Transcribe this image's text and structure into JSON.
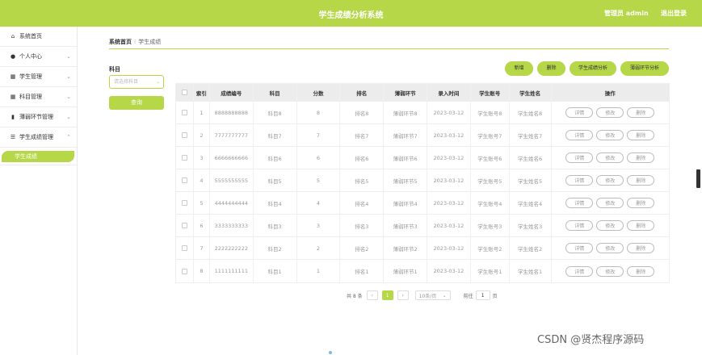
{
  "header": {
    "title": "学生成绩分析系统",
    "user": "管理员 admin",
    "logout": "退出登录"
  },
  "sidebar": {
    "items": [
      {
        "icon": "home-icon",
        "glyph": "⌂",
        "label": "系统首页",
        "chevron": ""
      },
      {
        "icon": "user-icon",
        "glyph": "●",
        "label": "个人中心",
        "chevron": "⌄"
      },
      {
        "icon": "grid-icon",
        "glyph": "▦",
        "label": "学生管理",
        "chevron": "⌄"
      },
      {
        "icon": "grid-icon",
        "glyph": "▦",
        "label": "科目管理",
        "chevron": "⌄"
      },
      {
        "icon": "bar-chart-icon",
        "glyph": "▮",
        "label": "薄弱环节管理",
        "chevron": "⌄"
      },
      {
        "icon": "list-icon",
        "glyph": "☰",
        "label": "学生成绩管理",
        "chevron": "⌃"
      }
    ],
    "active_sub": "学生成绩"
  },
  "breadcrumb": {
    "home": "系统首页",
    "sep": "⁝",
    "current": "学生成绩"
  },
  "filter": {
    "label": "科目",
    "placeholder": "请选择科目",
    "arrow": "⌄",
    "query": "查询"
  },
  "actions": {
    "add": "新增",
    "delete": "删除",
    "analysis": "学生成绩分析",
    "weak_analysis": "薄弱环节分析"
  },
  "table": {
    "headers": [
      "索引",
      "成绩编号",
      "科目",
      "分数",
      "排名",
      "薄弱环节",
      "录入时间",
      "学生账号",
      "学生姓名",
      "操作"
    ],
    "rows": [
      [
        "1",
        "8888888888",
        "科目8",
        "8",
        "排名8",
        "薄弱环节8",
        "2023-03-12",
        "学生账号8",
        "学生姓名8"
      ],
      [
        "2",
        "7777777777",
        "科目7",
        "7",
        "排名7",
        "薄弱环节7",
        "2023-03-12",
        "学生账号7",
        "学生姓名7"
      ],
      [
        "3",
        "6666666666",
        "科目6",
        "6",
        "排名6",
        "薄弱环节6",
        "2023-03-12",
        "学生账号6",
        "学生姓名6"
      ],
      [
        "4",
        "5555555555",
        "科目5",
        "5",
        "排名5",
        "薄弱环节5",
        "2023-03-12",
        "学生账号5",
        "学生姓名5"
      ],
      [
        "5",
        "4444444444",
        "科目4",
        "4",
        "排名4",
        "薄弱环节4",
        "2023-03-12",
        "学生账号4",
        "学生姓名4"
      ],
      [
        "6",
        "3333333333",
        "科目3",
        "3",
        "排名3",
        "薄弱环节3",
        "2023-03-12",
        "学生账号3",
        "学生姓名3"
      ],
      [
        "7",
        "2222222222",
        "科目2",
        "2",
        "排名2",
        "薄弱环节2",
        "2023-03-12",
        "学生账号2",
        "学生姓名2"
      ],
      [
        "8",
        "1111111111",
        "科目1",
        "1",
        "排名1",
        "薄弱环节1",
        "2023-03-12",
        "学生账号1",
        "学生姓名1"
      ]
    ],
    "op_buttons": [
      "详情",
      "修改",
      "删除"
    ]
  },
  "pagination": {
    "total": "共 8 条",
    "prev": "‹",
    "page": "1",
    "next": "›",
    "size": "10条/页",
    "size_arrow": "⌄",
    "goto_label": "前往",
    "goto_value": "1",
    "page_suffix": "页"
  },
  "watermark": "CSDN @贤杰程序源码",
  "colors": {
    "accent": "#b5d748"
  }
}
